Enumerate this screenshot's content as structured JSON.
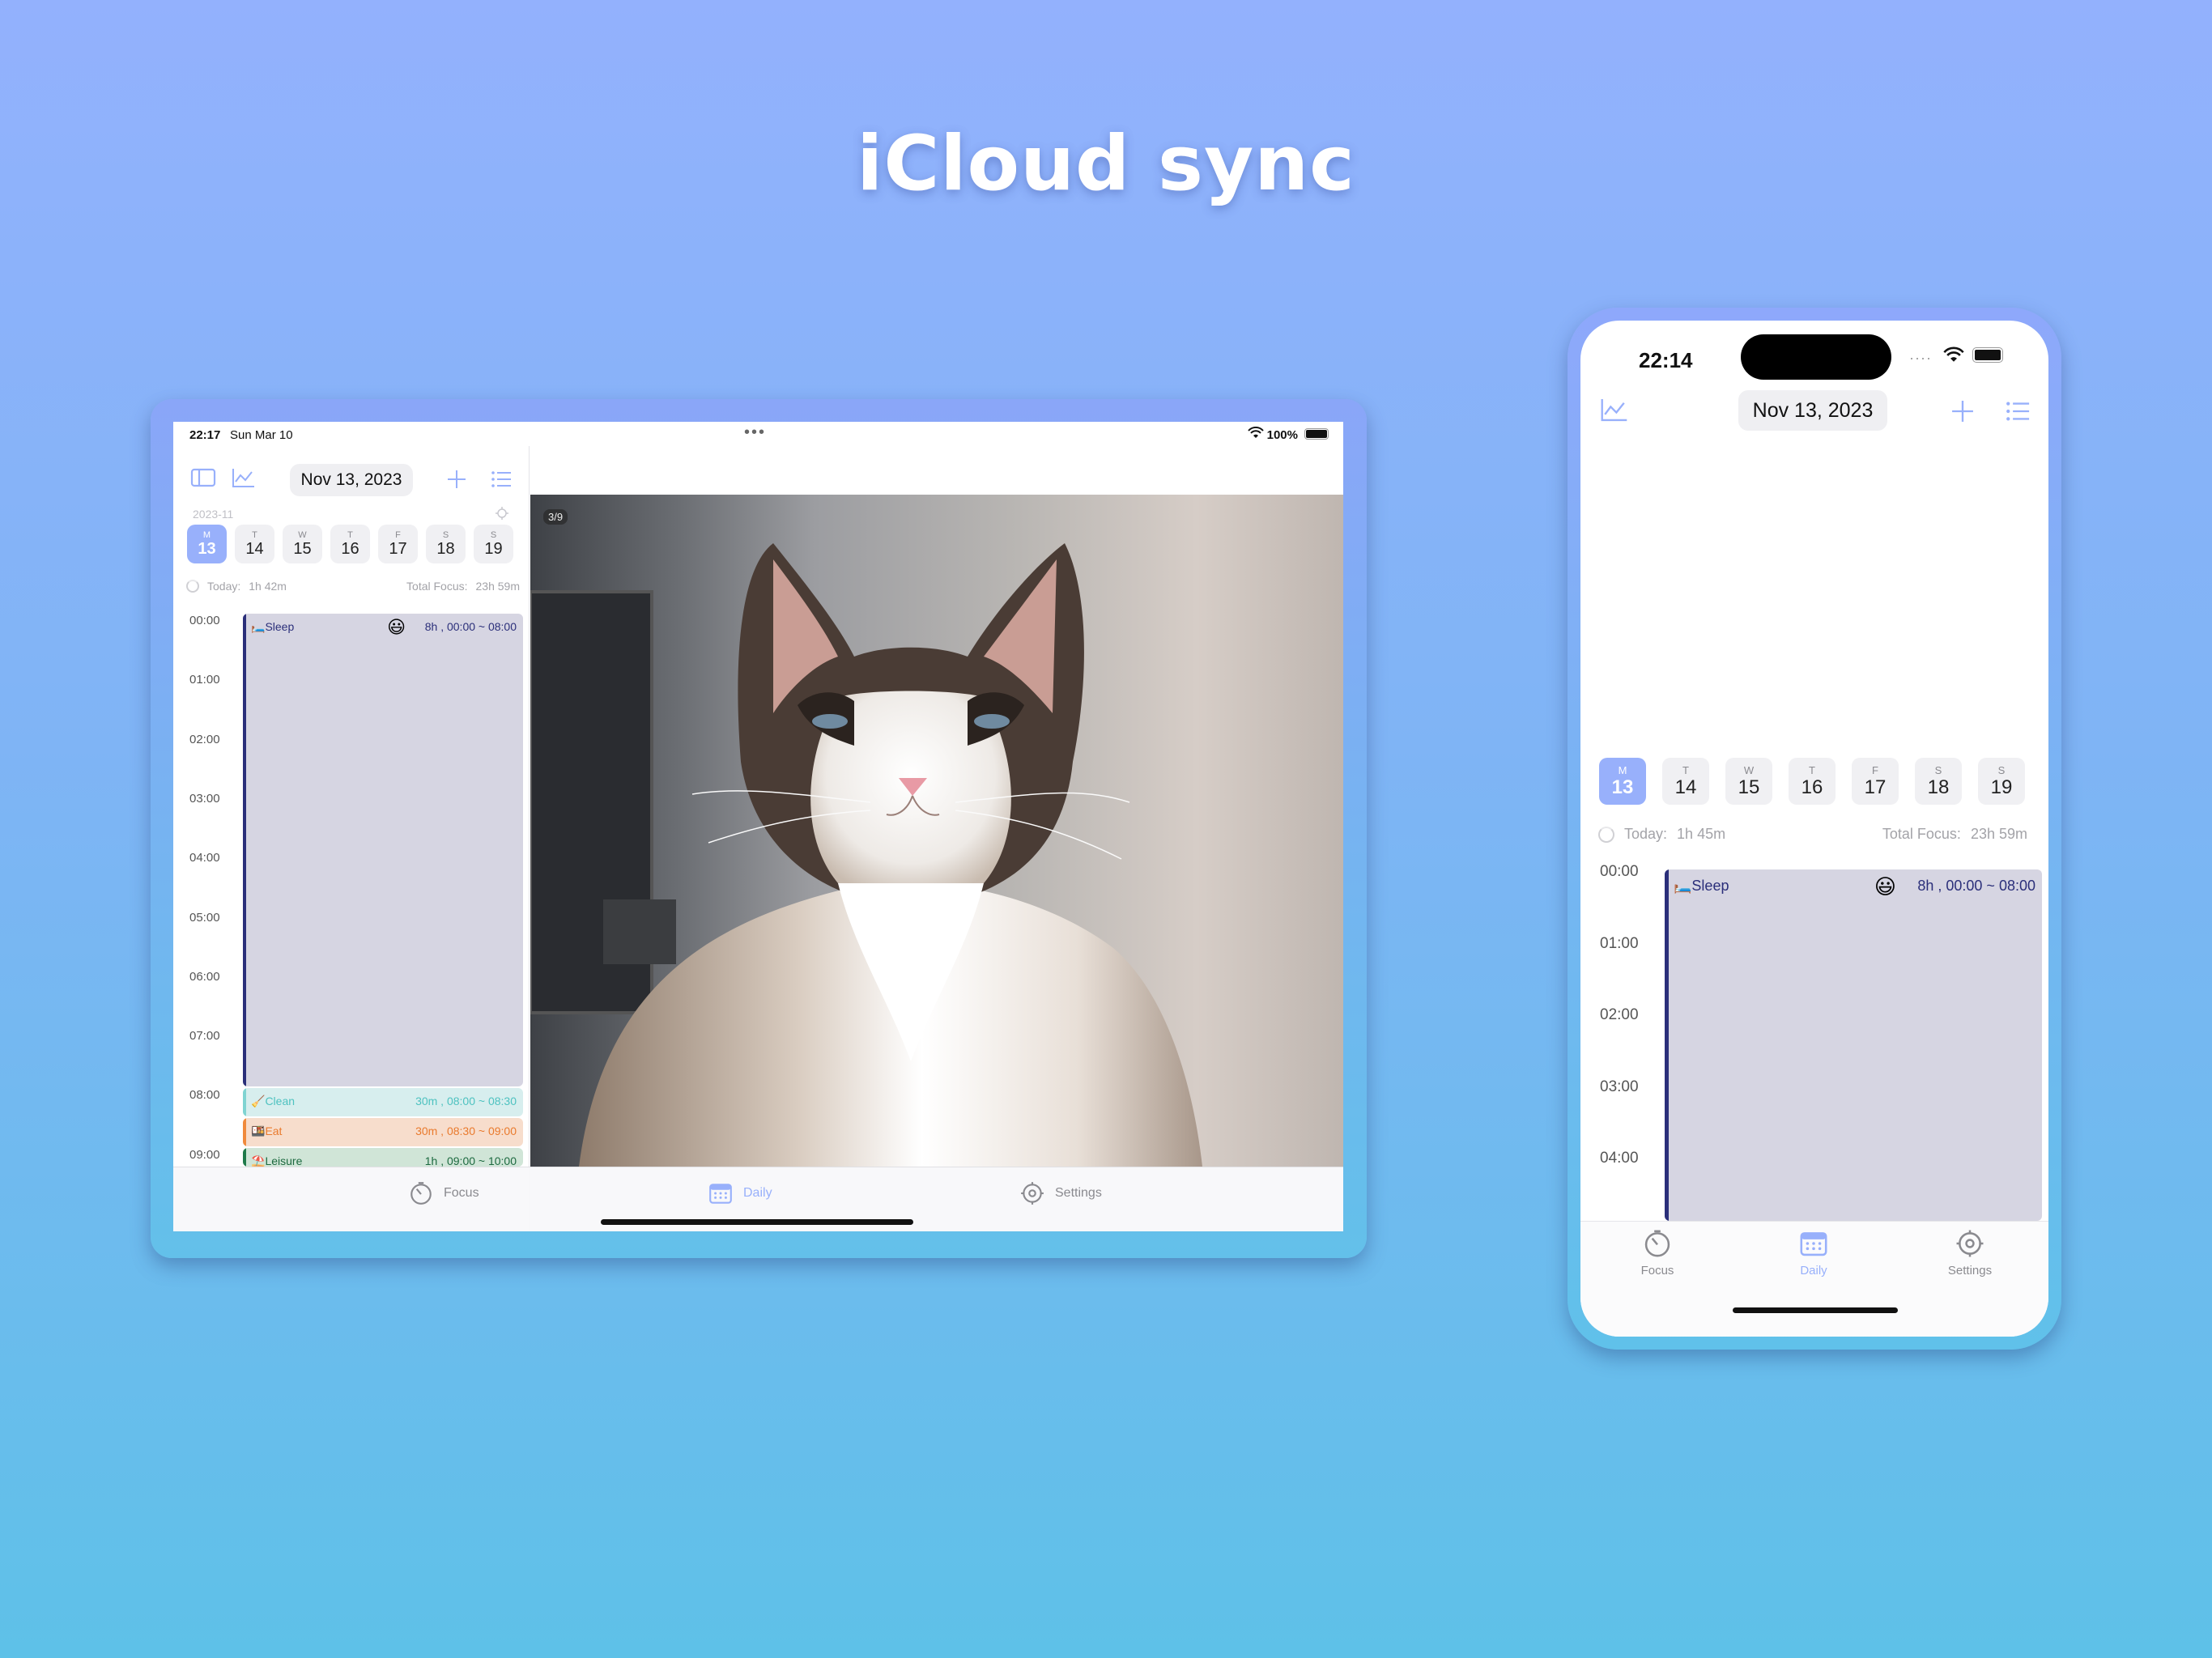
{
  "headline": "iCloud sync",
  "calendar": {
    "date_label": "Nov 13, 2023",
    "month_label": "2023-11",
    "week": [
      {
        "letter": "M",
        "num": "13",
        "selected": true
      },
      {
        "letter": "T",
        "num": "14",
        "selected": false
      },
      {
        "letter": "W",
        "num": "15",
        "selected": false
      },
      {
        "letter": "T",
        "num": "16",
        "selected": false
      },
      {
        "letter": "F",
        "num": "17",
        "selected": false
      },
      {
        "letter": "S",
        "num": "18",
        "selected": false
      },
      {
        "letter": "S",
        "num": "19",
        "selected": false
      }
    ],
    "today_label": "Today:",
    "total_focus_label": "Total Focus:",
    "total_focus_value": "23h 59m",
    "hours": [
      "00:00",
      "01:00",
      "02:00",
      "03:00",
      "04:00",
      "05:00",
      "06:00",
      "07:00",
      "08:00",
      "09:00"
    ],
    "events": [
      {
        "emoji": "🛏️",
        "name": "Sleep",
        "mood": "😃",
        "duration": "8h , 00:00 ~ 08:00",
        "color": "#2b2f7a",
        "bg": "#d6d5e2",
        "text": "#2b2f7a"
      },
      {
        "emoji": "🧹",
        "name": "Clean",
        "duration": "30m , 08:00 ~ 08:30",
        "color": "#7fd4d2",
        "bg": "#d7eeee",
        "text": "#4ec2c0"
      },
      {
        "emoji": "🍱",
        "name": "Eat",
        "duration": "30m , 08:30 ~ 09:00",
        "color": "#f08a3c",
        "bg": "#f7ddcc",
        "text": "#e97a2d"
      },
      {
        "emoji": "⛱️",
        "name": "Leisure",
        "duration": "1h , 09:00 ~ 10:00",
        "color": "#1f7a4a",
        "bg": "#d0e5d7",
        "text": "#1d6a40"
      }
    ]
  },
  "ipad": {
    "status_time": "22:17",
    "status_date": "Sun Mar 10",
    "battery": "100%",
    "today_value": "1h 42m",
    "photo_counter": "3/9"
  },
  "iphone": {
    "status_time": "22:14",
    "today_value": "1h 45m"
  },
  "tabs": [
    {
      "label": "Focus",
      "active": false
    },
    {
      "label": "Daily",
      "active": true
    },
    {
      "label": "Settings",
      "active": false
    }
  ],
  "colors": {
    "accent": "#98b0fb",
    "inactive": "#8a8a8f"
  }
}
